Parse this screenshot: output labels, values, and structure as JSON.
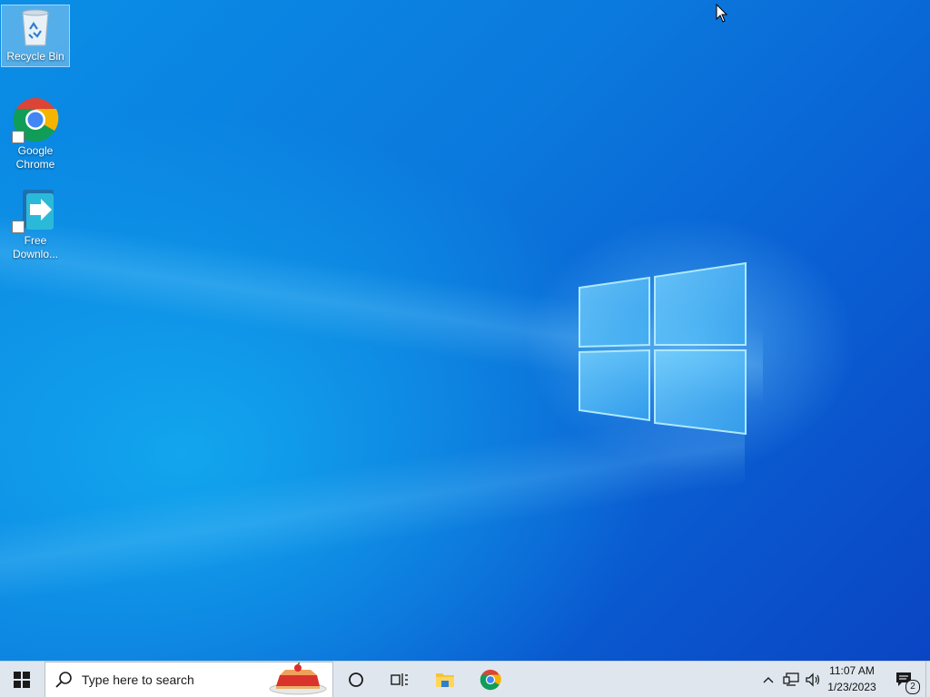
{
  "desktop": {
    "icons": [
      {
        "label_line1": "Recycle Bin",
        "label_line2": "",
        "icon": "recycle-bin-icon"
      },
      {
        "label_line1": "Google",
        "label_line2": "Chrome",
        "icon": "chrome-icon"
      },
      {
        "label_line1": "Free",
        "label_line2": "Downlo...",
        "icon": "free-download-manager-icon"
      }
    ]
  },
  "taskbar": {
    "start": "windows-start-icon",
    "search_placeholder": "Type here to search",
    "pinned": [
      "cortana-icon",
      "task-view-icon",
      "file-explorer-icon",
      "chrome-icon"
    ],
    "tray": {
      "time": "11:07 AM",
      "date": "1/23/2023",
      "notification_count": "2"
    }
  },
  "colors": {
    "desktop_blue": "#0b79dd",
    "taskbar_bg": "#dfe6ee"
  }
}
